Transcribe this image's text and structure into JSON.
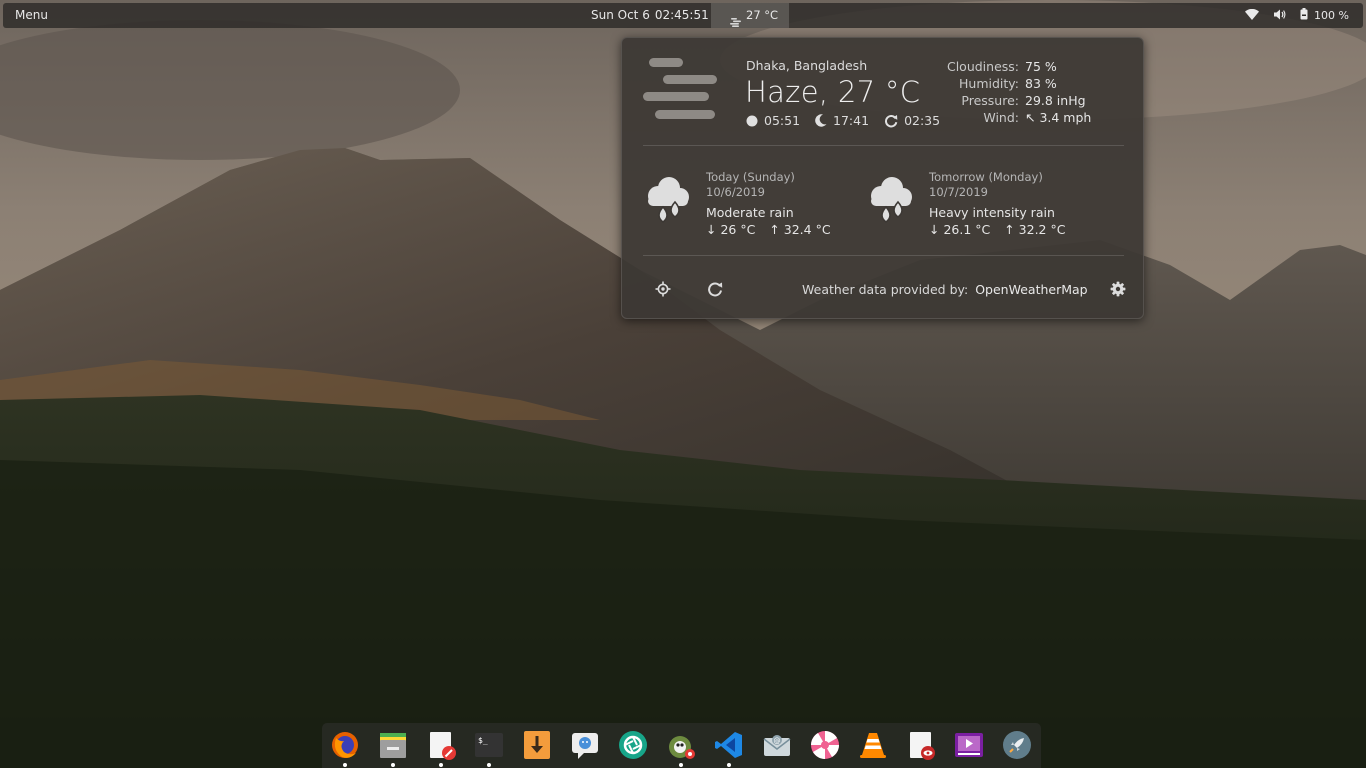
{
  "panel": {
    "menu_label": "Menu",
    "date": "Sun Oct 6",
    "time": "02:45:51",
    "indicator_temp": "27 °C",
    "battery": "100 %"
  },
  "weather": {
    "location": "Dhaka, Bangladesh",
    "summary": "Haze, 27 °C",
    "sunrise": "05:51",
    "sunset": "17:41",
    "build_time": "02:35",
    "details": [
      {
        "label": "Cloudiness:",
        "value": "75 %"
      },
      {
        "label": "Humidity:",
        "value": "83 %"
      },
      {
        "label": "Pressure:",
        "value": "29.8 inHg"
      },
      {
        "label": "Wind:",
        "value": "↖ 3.4 mph"
      }
    ],
    "forecast": [
      {
        "day": "Today (Sunday)",
        "date": "10/6/2019",
        "condition": "Moderate rain",
        "low": "↓ 26 °C",
        "high": "↑ 32.4 °C"
      },
      {
        "day": "Tomorrow (Monday)",
        "date": "10/7/2019",
        "condition": "Heavy intensity rain",
        "low": "↓ 26.1 °C",
        "high": "↑ 32.2 °C"
      }
    ],
    "attribution_label": "Weather data provided by:",
    "provider": "OpenWeatherMap"
  },
  "dock": {
    "items": [
      {
        "name": "firefox",
        "running": true
      },
      {
        "name": "files",
        "running": true
      },
      {
        "name": "text-editor",
        "running": true
      },
      {
        "name": "terminal",
        "running": true
      },
      {
        "name": "downloader",
        "running": false
      },
      {
        "name": "chat",
        "running": false
      },
      {
        "name": "screenshot",
        "running": false
      },
      {
        "name": "gimp",
        "running": true
      },
      {
        "name": "vscode",
        "running": true
      },
      {
        "name": "mail",
        "running": false
      },
      {
        "name": "lollypop",
        "running": false
      },
      {
        "name": "vlc",
        "running": false
      },
      {
        "name": "document-viewer",
        "running": false
      },
      {
        "name": "video-player",
        "running": false
      },
      {
        "name": "launcher",
        "running": false
      }
    ]
  }
}
